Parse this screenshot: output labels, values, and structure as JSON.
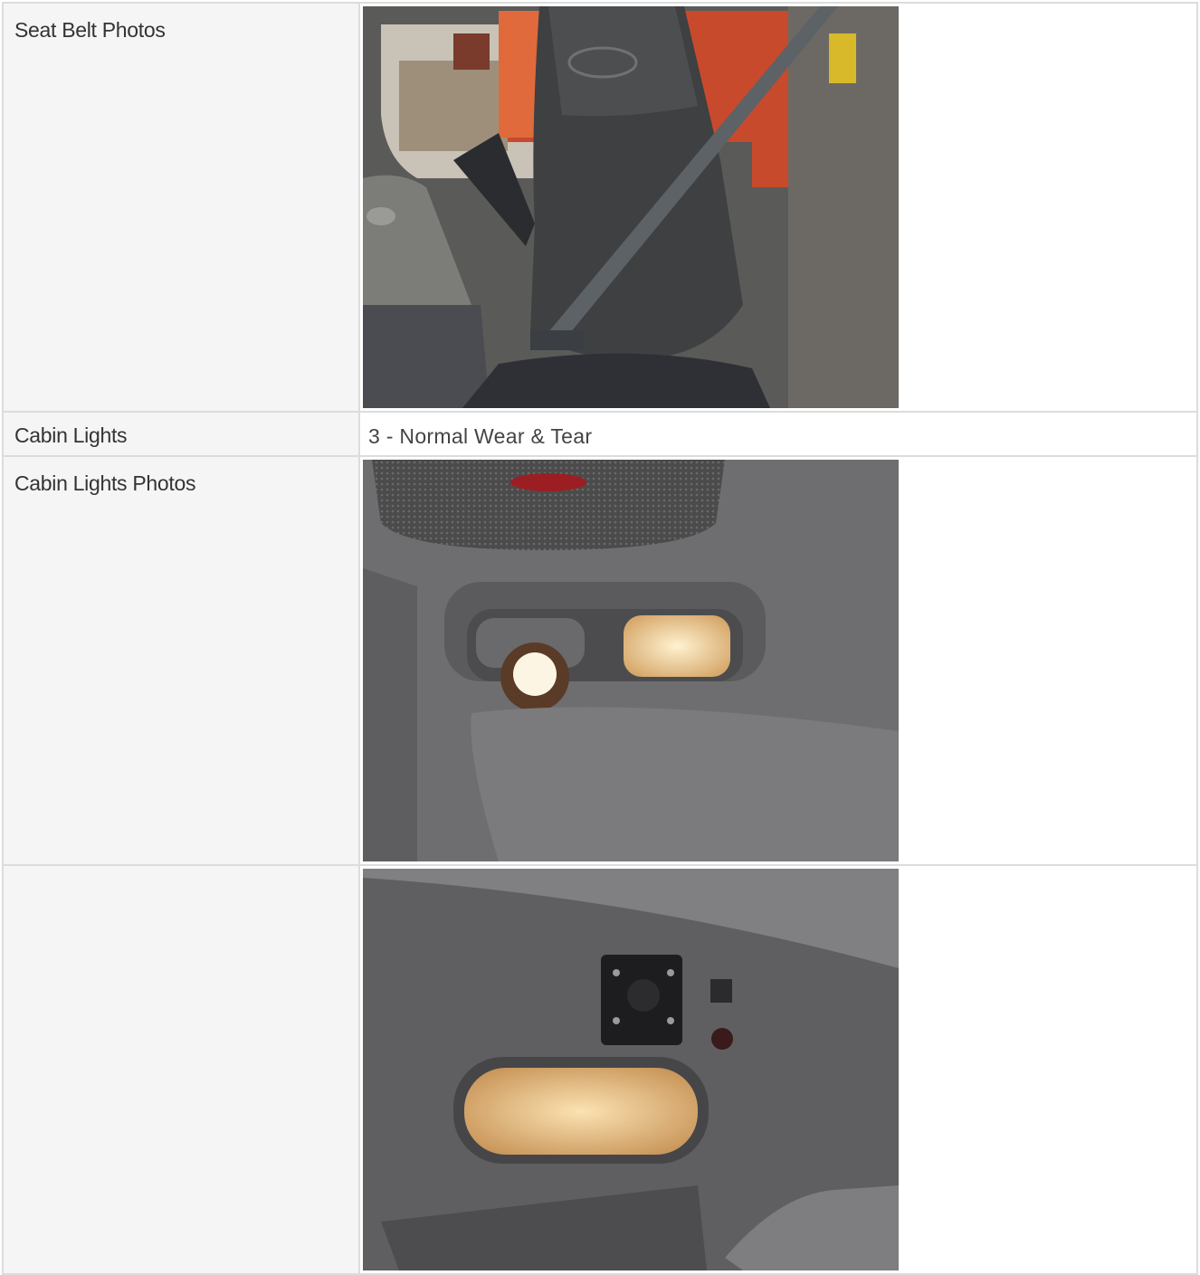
{
  "rows": [
    {
      "label": "Seat Belt Photos",
      "photo": "seat-belt-photo"
    },
    {
      "label": "Cabin Lights",
      "value": "3 - Normal Wear & Tear"
    },
    {
      "label": "Cabin Lights Photos",
      "photo": "cabin-lights-photo-1"
    },
    {
      "label": "",
      "photo": "cabin-lights-photo-2"
    }
  ]
}
